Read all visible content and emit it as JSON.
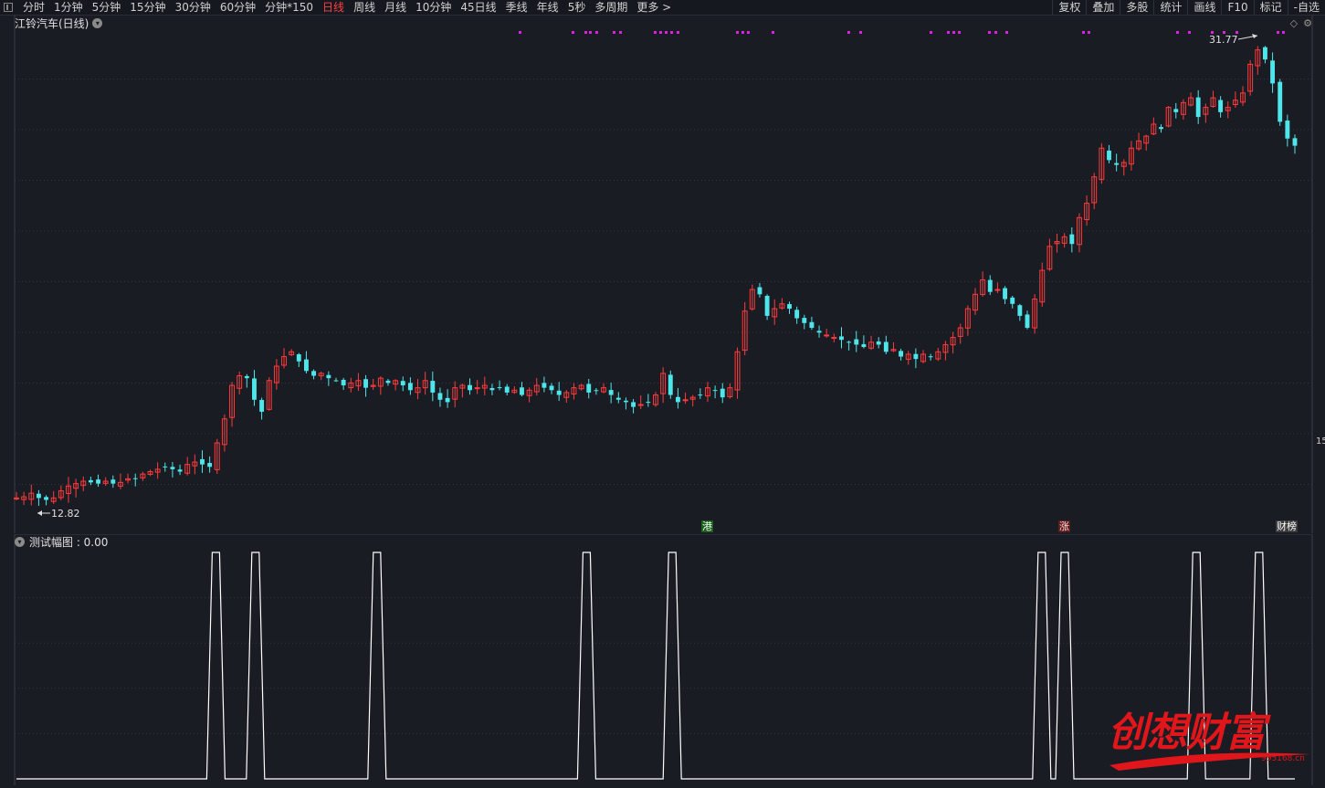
{
  "toolbar": {
    "periods": [
      "分时",
      "1分钟",
      "5分钟",
      "15分钟",
      "30分钟",
      "60分钟",
      "分钟*150",
      "日线",
      "周线",
      "月线",
      "10分钟",
      "45日线",
      "季线",
      "年线",
      "5秒",
      "多周期",
      "更多 >"
    ],
    "active_period": "日线",
    "right_buttons": [
      "复权",
      "叠加",
      "多股",
      "统计",
      "画线",
      "F10",
      "标记",
      "-自选"
    ]
  },
  "main": {
    "title": "江铃汽车(日线)",
    "high_label": "31.77",
    "low_label": "12.82",
    "price_tick_label": "15",
    "flags": {
      "gang": "港",
      "zhang": "涨",
      "caibang": "财榜"
    },
    "top_right_icons": [
      "diamond-icon",
      "gear-icon"
    ]
  },
  "indicator": {
    "title": "测试幅图 : 0.00"
  },
  "watermark": {
    "text": "创想财富",
    "url": "995168.cn"
  },
  "colors": {
    "up": "#ff3b3b",
    "down": "#4ee6ea",
    "background": "#1a1c24",
    "grid": "#333640",
    "magenta_marker": "#e020e0",
    "indicator_line": "#ffffff",
    "active_tab": "#ff4040"
  },
  "chart_data": [
    {
      "type": "candlestick",
      "title": "江铃汽车(日线)",
      "y_range": [
        12.0,
        32.5
      ],
      "series_desc": "daily OHLC; close path values in price units",
      "close_path": [
        12.9,
        12.95,
        13.1,
        12.9,
        12.82,
        12.9,
        13.2,
        13.4,
        13.5,
        13.6,
        13.55,
        13.5,
        13.6,
        13.5,
        13.55,
        13.7,
        13.7,
        13.9,
        14.0,
        14.1,
        14.2,
        14.1,
        14.0,
        14.3,
        14.4,
        14.3,
        14.2,
        15.2,
        16.2,
        17.6,
        18.0,
        17.9,
        17.0,
        16.5,
        17.8,
        18.4,
        18.8,
        19.0,
        18.6,
        18.2,
        18.0,
        18.1,
        17.9,
        17.8,
        17.6,
        17.7,
        17.8,
        17.5,
        17.6,
        17.9,
        17.7,
        17.8,
        17.6,
        17.4,
        17.5,
        17.8,
        17.3,
        17.0,
        16.9,
        17.5,
        17.6,
        17.4,
        17.5,
        17.6,
        17.4,
        17.5,
        17.3,
        17.4,
        17.2,
        17.4,
        17.6,
        17.5,
        17.4,
        17.2,
        17.3,
        17.5,
        17.6,
        17.3,
        17.4,
        17.5,
        17.2,
        17.0,
        16.9,
        16.7,
        16.8,
        16.9,
        17.2,
        18.1,
        17.2,
        16.9,
        17.0,
        17.1,
        17.2,
        17.5,
        17.4,
        17.1,
        17.5,
        19.0,
        20.7,
        21.6,
        21.4,
        20.5,
        20.8,
        21.0,
        20.8,
        20.4,
        20.2,
        20.0,
        19.8,
        19.7,
        19.6,
        19.5,
        19.4,
        19.3,
        19.2,
        19.4,
        19.3,
        19.0,
        19.1,
        18.8,
        18.9,
        18.7,
        18.9,
        18.8,
        19.0,
        19.3,
        19.6,
        20.0,
        20.8,
        21.4,
        22.0,
        21.5,
        21.6,
        21.2,
        21.0,
        20.5,
        20.0,
        21.2,
        22.4,
        23.4,
        23.6,
        23.8,
        23.5,
        24.6,
        25.2,
        26.3,
        27.5,
        27.0,
        26.8,
        26.9,
        27.5,
        27.8,
        28.0,
        28.5,
        28.3,
        29.2,
        29.0,
        29.4,
        29.6,
        28.8,
        29.2,
        29.6,
        29.0,
        29.2,
        29.5,
        29.8,
        31.0,
        31.6,
        31.2,
        30.2,
        28.6,
        27.9,
        27.6
      ],
      "annotations": {
        "high": 31.77,
        "low": 12.82
      }
    },
    {
      "type": "line",
      "title": "测试幅图",
      "value": 0.0,
      "peak_positions_pct": [
        15.6,
        18.7,
        28.2,
        44.6,
        51.3,
        80.2,
        82.0,
        92.3,
        97.2
      ],
      "peak_value": 1.0
    }
  ]
}
